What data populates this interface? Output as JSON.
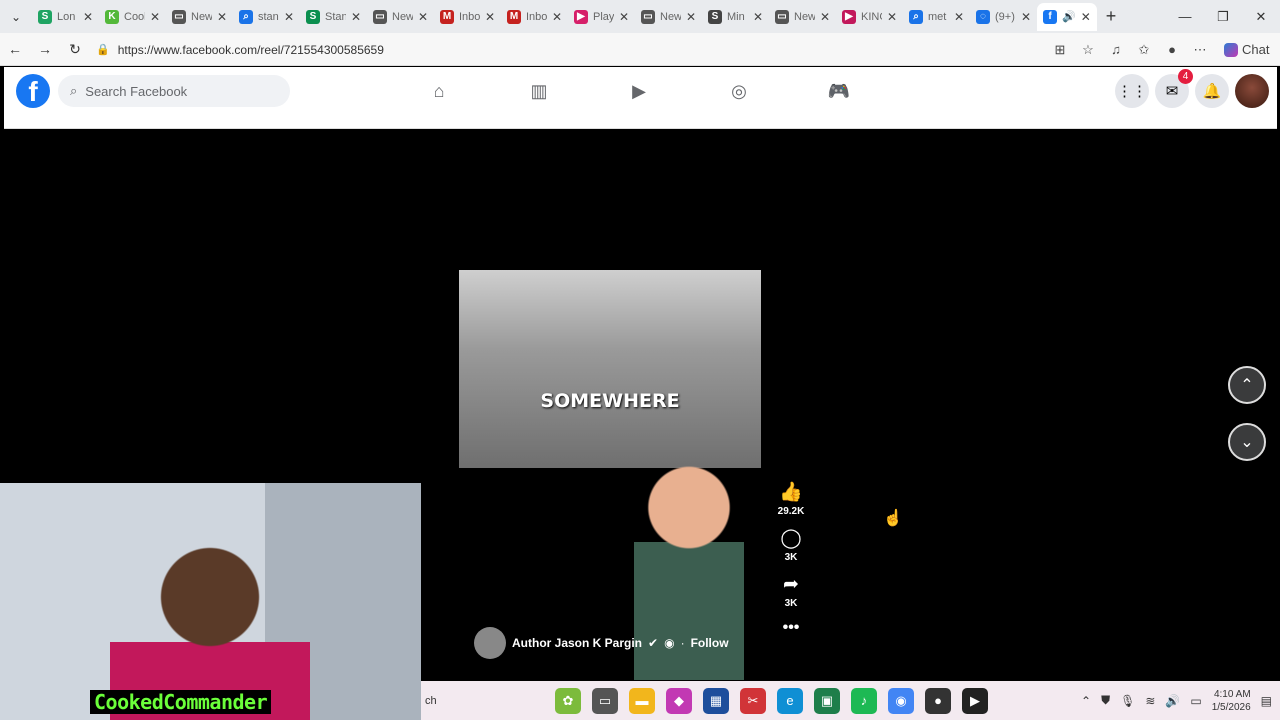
{
  "browser": {
    "tabs": [
      {
        "label": "Lon",
        "icon": "s-icon",
        "color": "#1fa463"
      },
      {
        "label": "Cool",
        "icon": "k-icon",
        "color": "#53b83a"
      },
      {
        "label": "New",
        "icon": "page-icon",
        "color": "#555555",
        "active": true
      },
      {
        "label": "stan",
        "icon": "search-icon",
        "color": "#1a73e8"
      },
      {
        "label": "Stan",
        "icon": "s-icon",
        "color": "#0b8f4f"
      },
      {
        "label": "New",
        "icon": "page-icon",
        "color": "#555555"
      },
      {
        "label": "Inbo",
        "icon": "mail-icon",
        "color": "#c5221f"
      },
      {
        "label": "Inbo",
        "icon": "mail-icon",
        "color": "#c5221f"
      },
      {
        "label": "Play",
        "icon": "play-icon",
        "color": "#d61f69"
      },
      {
        "label": "New",
        "icon": "page-icon",
        "color": "#555555"
      },
      {
        "label": "Min",
        "icon": "s-icon",
        "color": "#444444"
      },
      {
        "label": "New",
        "icon": "page-icon",
        "color": "#555555"
      },
      {
        "label": "KING",
        "icon": "video-icon",
        "color": "#c2185b"
      },
      {
        "label": "met",
        "icon": "search-icon",
        "color": "#1a73e8"
      },
      {
        "label": "(9+)",
        "icon": "loading-icon",
        "color": "#1a73e8"
      }
    ],
    "active_tab_icon": "facebook-icon",
    "url": "https://www.facebook.com/reel/721554300585659",
    "chat_label": "Chat"
  },
  "facebook": {
    "search_placeholder": "Search Facebook",
    "messenger_badge": "4"
  },
  "reel": {
    "overlay_text": "SOMEWHERE",
    "author": "Author Jason K Pargin",
    "follow": "Follow",
    "likes": "29.2K",
    "comments": "3K",
    "shares": "3K"
  },
  "webcam": {
    "name": "CookedCommander"
  },
  "taskbar": {
    "search_fragment": "ch",
    "time": "4:10 AM",
    "date": "1/5/2026"
  }
}
